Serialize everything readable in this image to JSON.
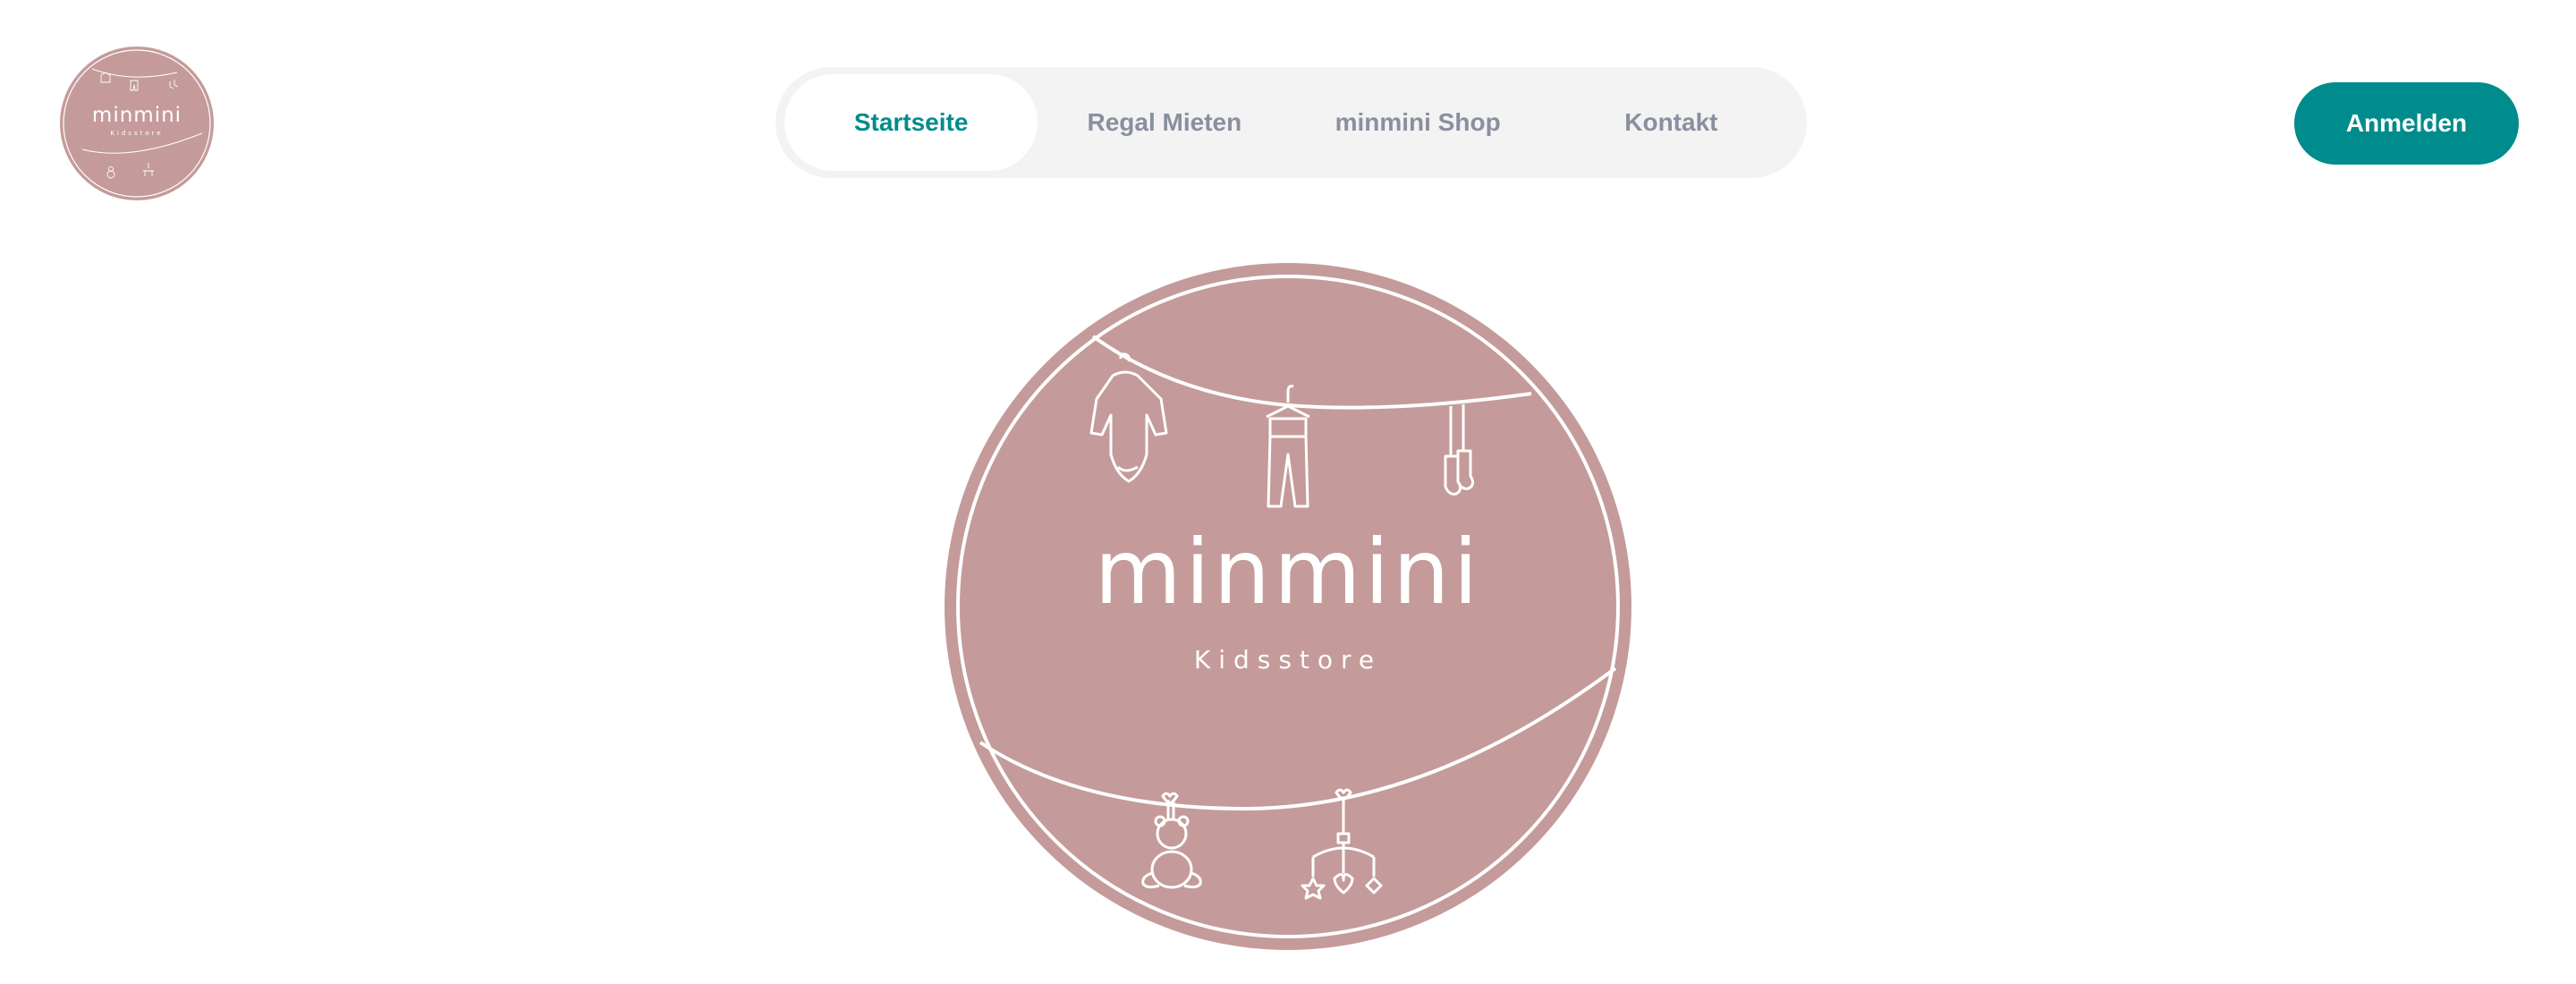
{
  "brand": {
    "name": "minmini",
    "tagline": "Kidsstore",
    "logo_color": "#c49b9a"
  },
  "nav": {
    "items": [
      {
        "label": "Startseite",
        "active": true
      },
      {
        "label": "Regal Mieten",
        "active": false
      },
      {
        "label": "minmini Shop",
        "active": false
      },
      {
        "label": "Kontakt",
        "active": false
      }
    ]
  },
  "header": {
    "login_label": "Anmelden"
  },
  "colors": {
    "accent": "#008c8c",
    "nav_inactive": "#8a8f9e",
    "nav_background": "#f3f3f4"
  },
  "icons": {
    "hero": [
      "bodysuit-icon",
      "pants-icon",
      "socks-icon",
      "teddy-bear-icon",
      "baby-mobile-icon"
    ]
  }
}
